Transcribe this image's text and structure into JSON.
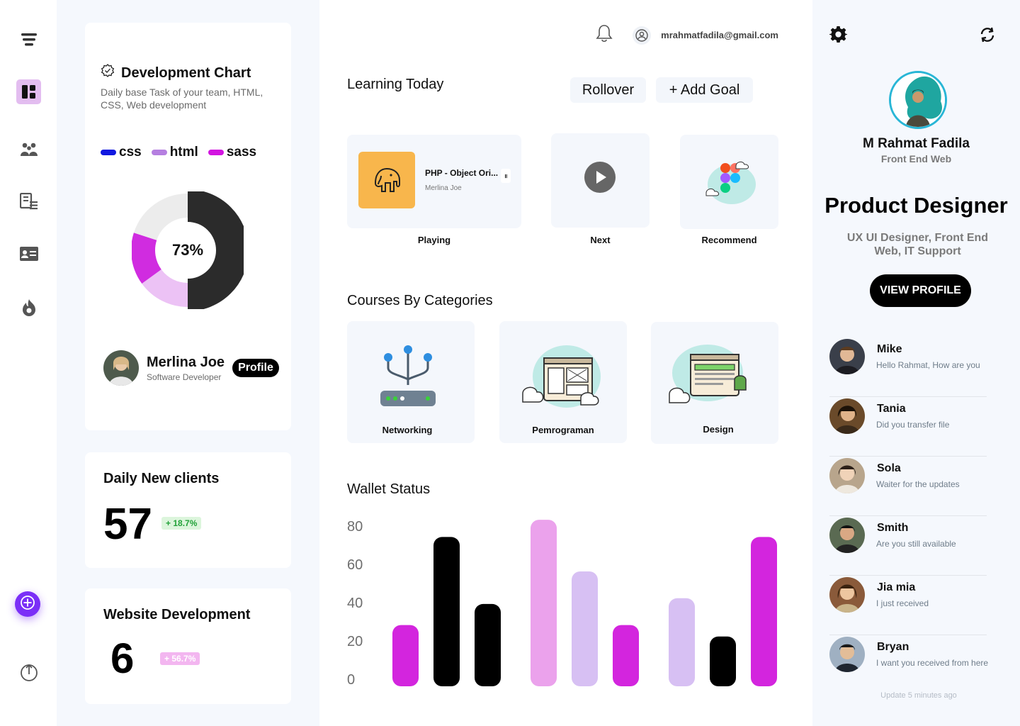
{
  "sidebar": {
    "icons": [
      "menu-icon",
      "dashboard-icon",
      "users-icon",
      "library-icon",
      "contact-card-icon",
      "fire-icon"
    ],
    "fab_icon": "plus-icon",
    "logout_icon": "logout-icon"
  },
  "dev_card": {
    "title": "Development Chart",
    "subtitle": "Daily base Task of your team, HTML, CSS, Web development",
    "legend": [
      {
        "label": "css",
        "color": "#1018e0"
      },
      {
        "label": "html",
        "color": "#b57fe0"
      },
      {
        "label": "sass",
        "color": "#d214e0"
      }
    ],
    "donut_label": "73%",
    "donut_segments": [
      {
        "name": "dark",
        "value": 50,
        "color": "#2b2b2b"
      },
      {
        "name": "light-pink",
        "value": 15,
        "color": "#ecc2f5"
      },
      {
        "name": "magenta",
        "value": 15,
        "color": "#d02ce0"
      },
      {
        "name": "grey",
        "value": 20,
        "color": "#ececec"
      }
    ],
    "person_name": "Merlina Joe",
    "person_role": "Software Developer",
    "profile_label": "Profile"
  },
  "clients_card": {
    "title": "Daily New clients",
    "value": "57",
    "change": "+ 18.7%"
  },
  "web_card": {
    "title": "Website Development",
    "value": "6",
    "change": "+ 56.7%"
  },
  "topbar": {
    "email": "mrahmatfadila@gmail.com"
  },
  "learning": {
    "title": "Learning Today",
    "rollover_label": "Rollover",
    "add_goal_label": "+ Add Goal",
    "playing_title": "PHP - Object Ori...",
    "playing_author": "Merlina Joe",
    "playing_pause": "॥",
    "captions": [
      "Playing",
      "Next",
      "Recommend"
    ]
  },
  "courses": {
    "title": "Courses By Categories",
    "items": [
      "Networking",
      "Pemrograman",
      "Design"
    ]
  },
  "wallet": {
    "title": "Wallet Status"
  },
  "chart_data": {
    "type": "bar",
    "title": "Wallet Status",
    "yticks": [
      "80",
      "60",
      "40",
      "20",
      "0"
    ],
    "ylim": [
      0,
      80
    ],
    "groups": [
      {
        "values": [
          32,
          78,
          43
        ],
        "colors": [
          "#d325de",
          "#000000",
          "#000000"
        ]
      },
      {
        "values": [
          87,
          60,
          32
        ],
        "colors": [
          "#eba2ec",
          "#d7c0f3",
          "#d325de"
        ]
      },
      {
        "values": [
          46,
          26,
          78
        ],
        "colors": [
          "#d7c0f3",
          "#000000",
          "#d325de"
        ]
      }
    ]
  },
  "profile": {
    "name": "M Rahmat Fadila",
    "role": "Front End Web",
    "headline": "Product Designer",
    "skills": "UX UI Designer, Front End Web, IT Support",
    "view_label": "VIEW PROFILE",
    "settings_icon": "gear-icon",
    "refresh_icon": "refresh-icon"
  },
  "messages": [
    {
      "name": "Mike",
      "text": "Hello Rahmat, How are you",
      "avatar_color": "#3a3f4a"
    },
    {
      "name": "Tania",
      "text": "Did you transfer file",
      "avatar_color": "#6a4a2a"
    },
    {
      "name": "Sola",
      "text": "Waiter for the updates",
      "avatar_color": "#b8a58c"
    },
    {
      "name": "Smith",
      "text": "Are you still available",
      "avatar_color": "#5a6a52"
    },
    {
      "name": "Jia mia",
      "text": "I just received",
      "avatar_color": "#8a5a3a"
    },
    {
      "name": "Bryan",
      "text": "I want you received from here",
      "avatar_color": "#9fb0c2"
    }
  ],
  "update_note": "Update 5 minutes ago"
}
